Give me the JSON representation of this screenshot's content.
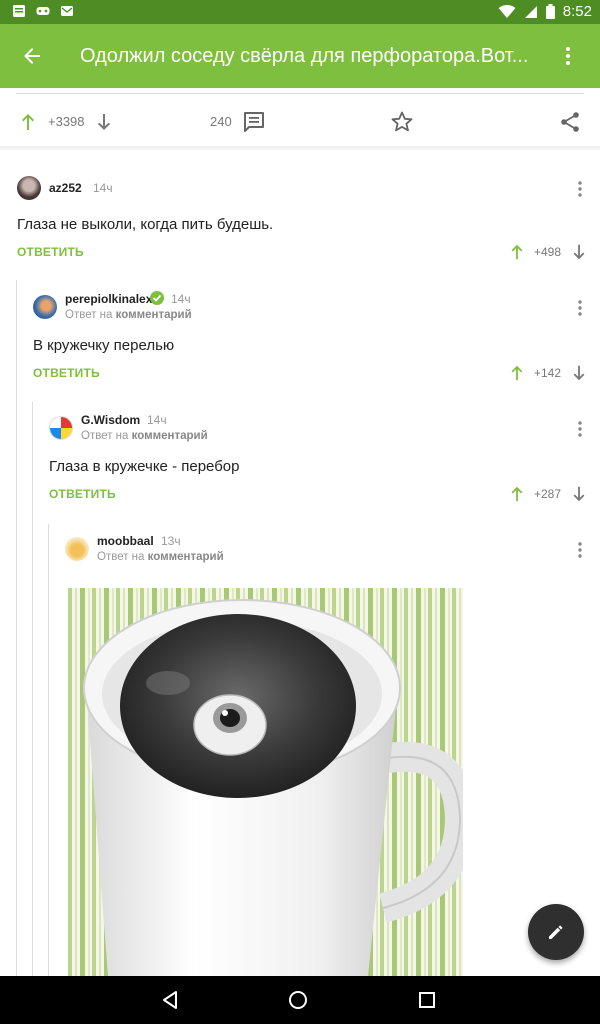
{
  "status_bar": {
    "time": "8:52"
  },
  "app_bar": {
    "title": "Одолжил соседу свёрла для перфоратора.Вот..."
  },
  "post_actions": {
    "score": "+3398",
    "comments_count": "240"
  },
  "comments": [
    {
      "user": "az252",
      "time": "14ч",
      "text": "Глаза не выколи, когда пить будешь.",
      "reply_label": "ОТВЕТИТЬ",
      "score": "+498"
    },
    {
      "user": "perepiolkinalex",
      "time": "14ч",
      "reply_prefix": "Ответ на",
      "reply_target": "комментарий",
      "text": "В кружечку перелью",
      "reply_label": "ОТВЕТИТЬ",
      "score": "+142"
    },
    {
      "user": "G.Wisdom",
      "time": "14ч",
      "reply_prefix": "Ответ на",
      "reply_target": "комментарий",
      "text": "Глаза в кружечке - перебор",
      "reply_label": "ОТВЕТИТЬ",
      "score": "+287"
    },
    {
      "user": "moobbaal",
      "time": "13ч",
      "reply_prefix": "Ответ на",
      "reply_target": "комментарий"
    }
  ],
  "colors": {
    "status_bar": "#4e8c24",
    "app_bar": "#7fbf3f",
    "accent": "#7fbf3f",
    "fab": "#2f2f2f"
  }
}
